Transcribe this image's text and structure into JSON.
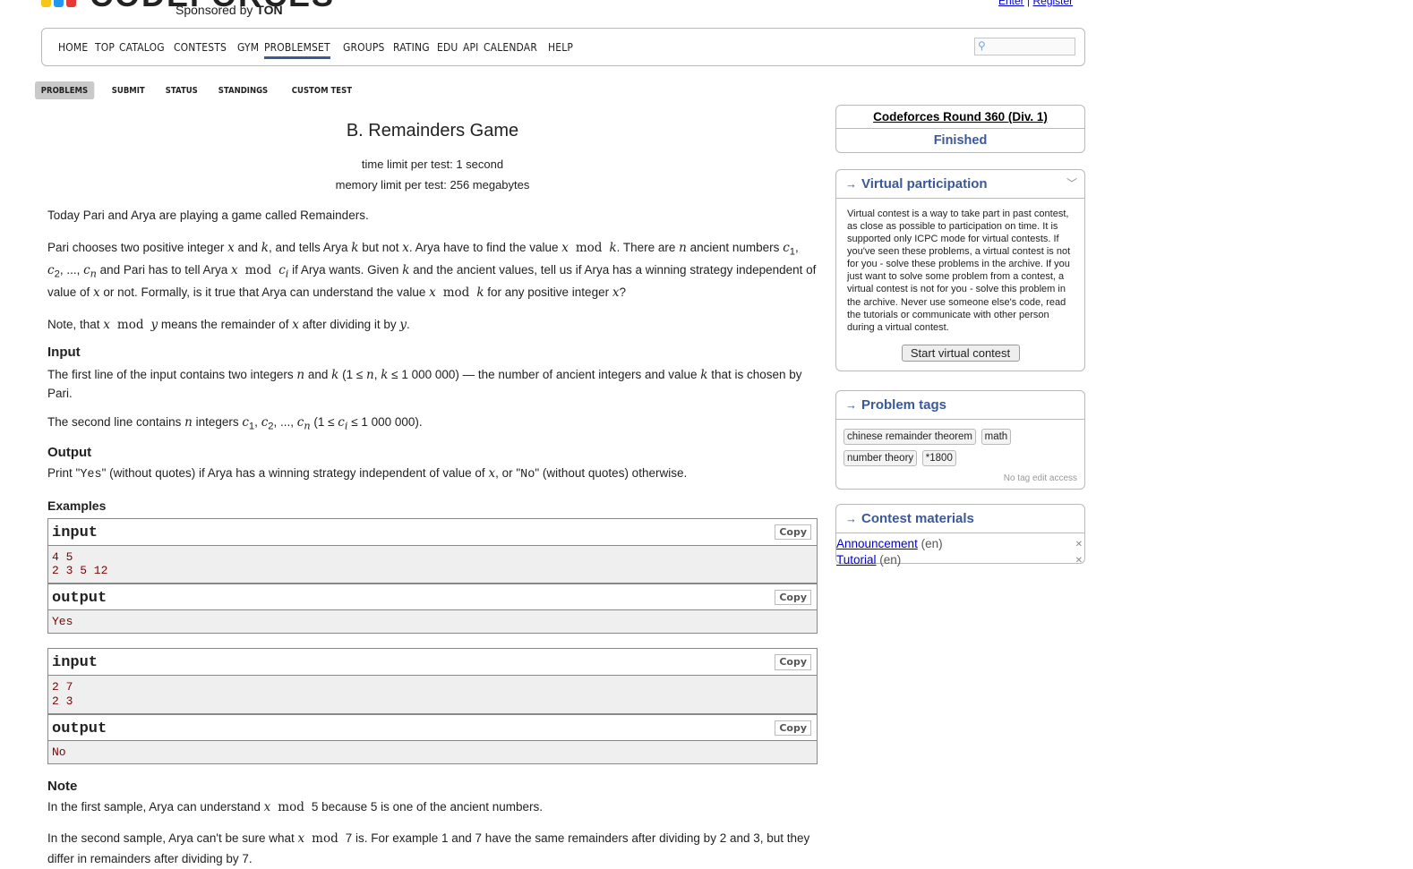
{
  "header": {
    "logo_text": "CODEFORCES",
    "sponsor_prefix": "Sponsored by",
    "sponsor_name": "TON",
    "top_links": [
      "Enter",
      "Register"
    ],
    "logo_colors": [
      "#f5c518",
      "#2196f3",
      "#e53935"
    ]
  },
  "menu": {
    "items": [
      "HOME",
      "TOP",
      "CATALOG",
      "CONTESTS",
      "GYM",
      "PROBLEMSET",
      "GROUPS",
      "RATING",
      "EDU",
      "API",
      "CALENDAR",
      "HELP"
    ],
    "active": "PROBLEMSET",
    "search_placeholder": ""
  },
  "subtabs": [
    "PROBLEMS",
    "SUBMIT",
    "STATUS",
    "STANDINGS",
    "CUSTOM TEST"
  ],
  "problem": {
    "title": "B. Remainders Game",
    "time_limit": "time limit per test: 1 second",
    "memory_limit": "memory limit per test: 256 megabytes",
    "legend_intro": "Today Pari and Arya are playing a game called Remainders.",
    "input_title": "Input",
    "output_title": "Output",
    "examples_title": "Examples",
    "note_title": "Note",
    "output_text_1": "Print \"",
    "output_yes": "Yes",
    "output_text_2": "\" (without quotes) if Arya has a winning strategy independent of value of",
    "output_text_3": ", or \"",
    "output_no": "No",
    "output_text_4": "\" (without quotes) otherwise.",
    "note_1_prefix": "In the first sample, Arya can understand",
    "note_1_suffix": "because 5 is one of the ancient numbers.",
    "note_2_prefix": "In the second sample, Arya can't be sure what",
    "note_2_suffix": "is. For example 1 and 7 have the same remainders after dividing by 2 and 3, but they differ in remainders after dividing by 7."
  },
  "samples": [
    {
      "input": "4 5\n2 3 5 12",
      "output": "Yes"
    },
    {
      "input": "2 7\n2 3",
      "output": "No"
    }
  ],
  "labels": {
    "input": "input",
    "output": "output",
    "copy": "Copy"
  },
  "sidebar": {
    "contest_name": "Codeforces Round 360 (Div. 1)",
    "contest_state": "Finished",
    "vp_title": "Virtual participation",
    "vp_text": "Virtual contest is a way to take part in past contest, as close as possible to participation on time. It is supported only ICPC mode for virtual contests. If you've seen these problems, a virtual contest is not for you - solve these problems in the archive. If you just want to solve some problem from a contest, a virtual contest is not for you - solve this problem in the archive. Never use someone else's code, read the tutorials or communicate with other person during a virtual contest.",
    "vp_button": "Start virtual contest",
    "tags_title": "Problem tags",
    "tags": [
      "chinese remainder theorem",
      "math",
      "number theory",
      "*1800"
    ],
    "no_tag_edit": "No tag edit access",
    "materials_title": "Contest materials",
    "materials": [
      {
        "name": "Announcement",
        "lang": "(en)"
      },
      {
        "name": "Tutorial",
        "lang": "(en)"
      }
    ]
  }
}
